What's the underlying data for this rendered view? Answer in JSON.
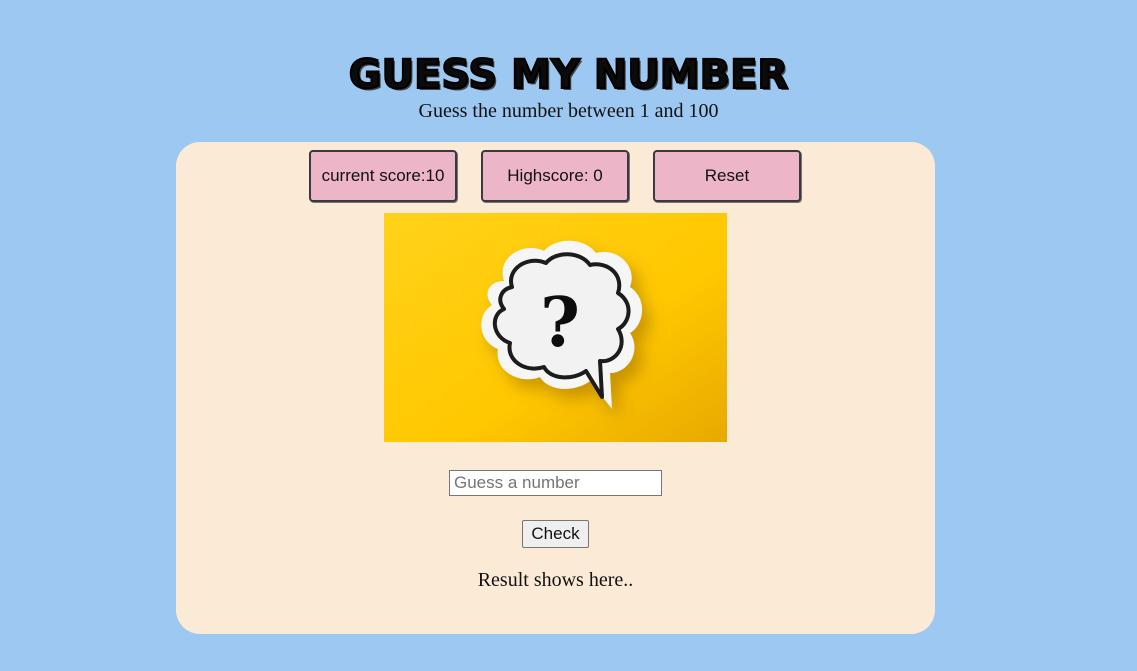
{
  "header": {
    "title": "GUESS MY NUMBER",
    "subtitle": "Guess the number between 1 and 100"
  },
  "stats": {
    "current_score_label": "current score:10",
    "highscore_label": "Highscore: 0",
    "reset_label": "Reset"
  },
  "image": {
    "icon": "question-speech-bubble",
    "background_color": "#ffcc00"
  },
  "guess": {
    "placeholder": "Guess a number",
    "value": "",
    "check_label": "Check"
  },
  "result": {
    "text": "Result shows here.."
  },
  "colors": {
    "page_background": "#9cc8f2",
    "card_background": "#fbebd6",
    "stat_button": "#ecb6c8"
  }
}
